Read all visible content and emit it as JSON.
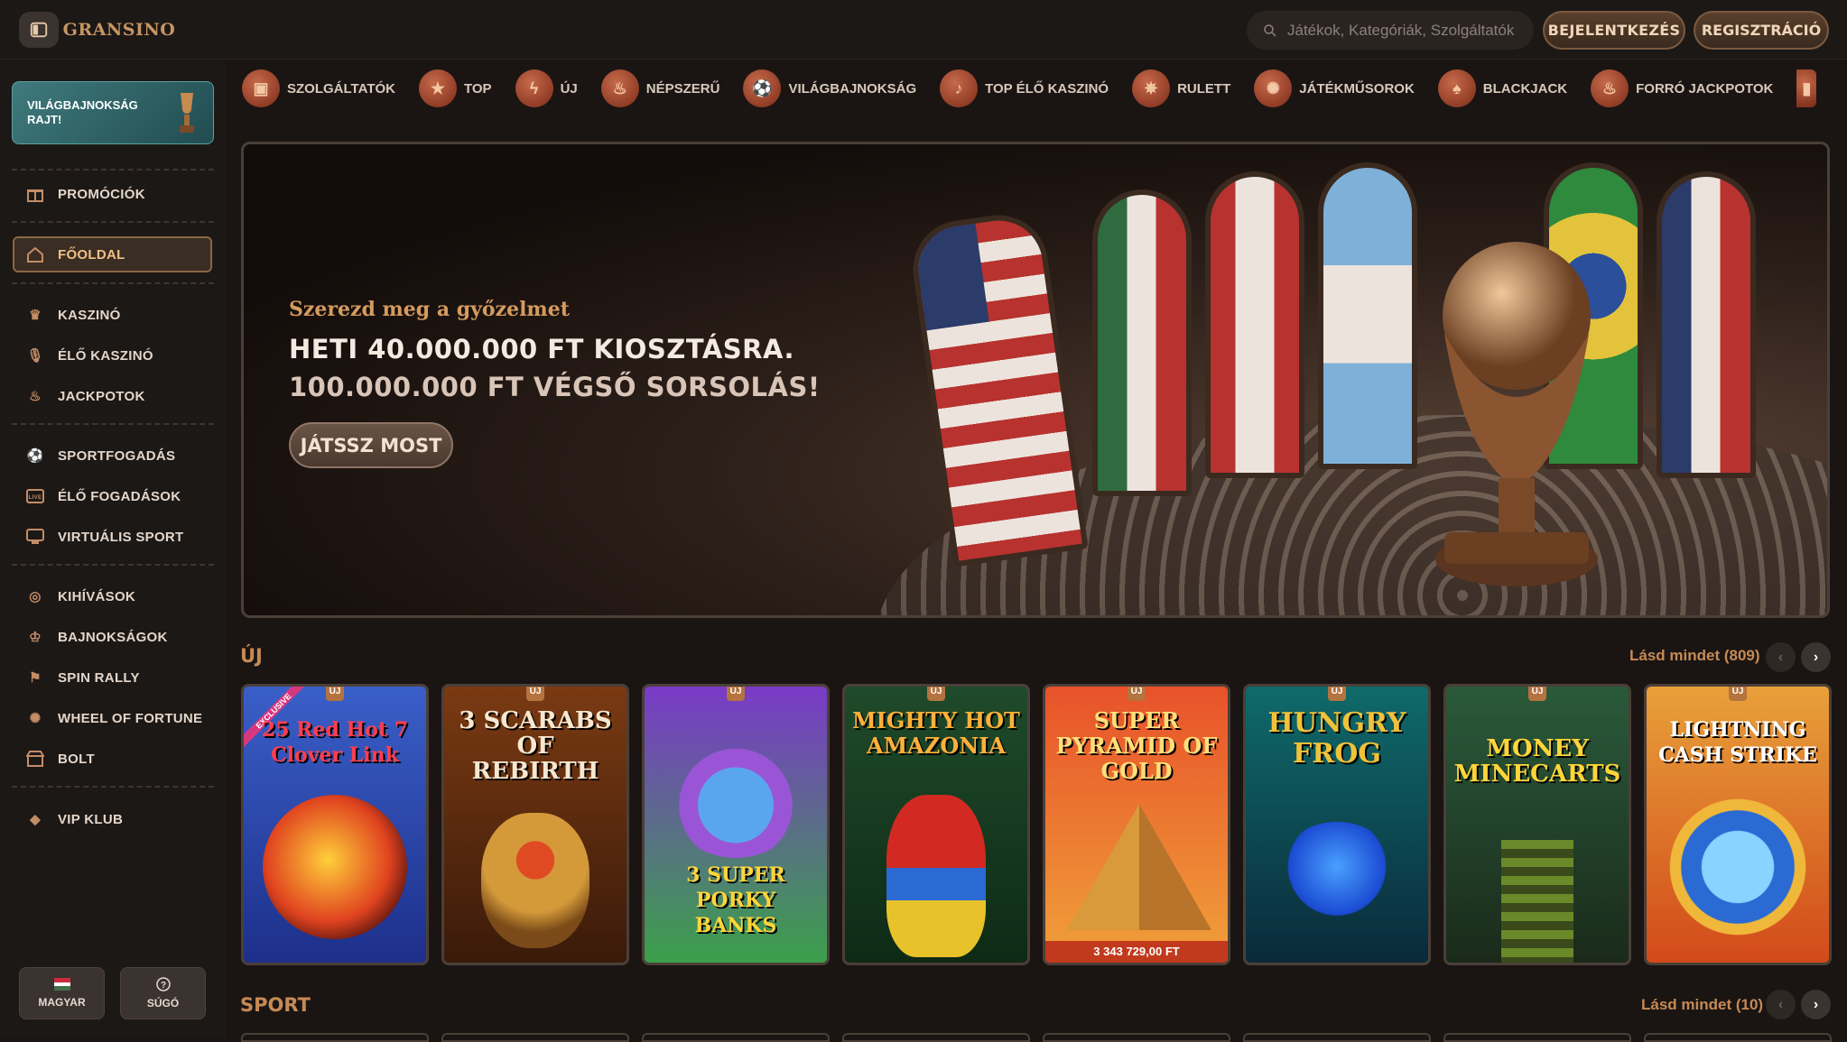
{
  "header": {
    "logo_text": "GRANSINO",
    "search_placeholder": "Játékok, Kategóriák, Szolgáltatók",
    "login_label": "BEJELENTKEZÉS",
    "register_label": "REGISZTRÁCIÓ"
  },
  "sidebar": {
    "promo_banner": "VILÁGBAJNOKSÁG RAJT!",
    "items": [
      {
        "label": "PROMÓCIÓK",
        "icon": "gift-icon"
      },
      {
        "label": "FŐOLDAL",
        "icon": "home-icon"
      },
      {
        "label": "KASZINÓ",
        "icon": "casino-icon"
      },
      {
        "label": "ÉLŐ KASZINÓ",
        "icon": "microphone-icon"
      },
      {
        "label": "JACKPOTOK",
        "icon": "jackpot-icon"
      },
      {
        "label": "SPORTFOGADÁS",
        "icon": "ball-icon"
      },
      {
        "label": "ÉLŐ FOGADÁSOK",
        "icon": "live-icon"
      },
      {
        "label": "VIRTUÁLIS SPORT",
        "icon": "virtual-icon"
      },
      {
        "label": "KIHÍVÁSOK",
        "icon": "medal-icon"
      },
      {
        "label": "BAJNOKSÁGOK",
        "icon": "trophy-icon"
      },
      {
        "label": "SPIN RALLY",
        "icon": "flag-icon"
      },
      {
        "label": "WHEEL OF FORTUNE",
        "icon": "wheel-icon"
      },
      {
        "label": "BOLT",
        "icon": "shop-icon"
      },
      {
        "label": "VIP KLUB",
        "icon": "diamond-icon"
      }
    ],
    "language_label": "MAGYAR",
    "help_label": "SÚGÓ"
  },
  "categories": [
    {
      "label": "SZOLGÁLTATÓK",
      "icon": "providers-icon"
    },
    {
      "label": "TOP",
      "icon": "star-icon"
    },
    {
      "label": "ÚJ",
      "icon": "lightning-icon"
    },
    {
      "label": "NÉPSZERŰ",
      "icon": "fire-icon"
    },
    {
      "label": "VILÁGBAJNOKSÁG",
      "icon": "football-icon"
    },
    {
      "label": "TOP ÉLŐ KASZINÓ",
      "icon": "microphone-icon"
    },
    {
      "label": "RULETT",
      "icon": "roulette-icon"
    },
    {
      "label": "JÁTÉKMŰSOROK",
      "icon": "wheel-icon"
    },
    {
      "label": "BLACKJACK",
      "icon": "cards-icon"
    },
    {
      "label": "FORRÓ JACKPOTOK",
      "icon": "hot-icon"
    }
  ],
  "hero": {
    "subtitle": "Szerezd meg a győzelmet",
    "line1": "HETI 40.000.000 FT KIOSZTÁSRA.",
    "line2": "100.000.000 FT VÉGSŐ SORSOLÁS!",
    "cta": "JÁTSSZ MOST"
  },
  "new_section": {
    "title": "ÚJ",
    "see_all": "Lásd mindet (809)",
    "games": [
      {
        "title": "25 Red Hot 7 Clover Link",
        "badge": "ÚJ",
        "exclusive": "EXCLUSIVE"
      },
      {
        "title": "3 SCARABS OF REBIRTH",
        "badge": "ÚJ"
      },
      {
        "title": "3 SUPER PORKY BANKS",
        "badge": "ÚJ"
      },
      {
        "title": "MIGHTY HOT AMAZONIA",
        "badge": "ÚJ"
      },
      {
        "title": "SUPER PYRAMID OF GOLD",
        "badge": "ÚJ",
        "jackpot": "3 343 729,00 FT"
      },
      {
        "title": "HUNGRY FROG",
        "badge": "ÚJ"
      },
      {
        "title": "MONEY MINECARTS",
        "badge": "ÚJ"
      },
      {
        "title": "LIGHTNING CASH STRIKE",
        "badge": "ÚJ"
      }
    ]
  },
  "sport_section": {
    "title": "SPORT",
    "see_all": "Lásd mindet (10)"
  }
}
